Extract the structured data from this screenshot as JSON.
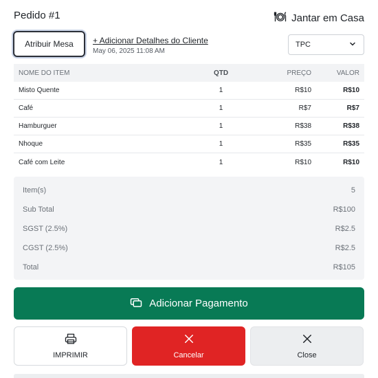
{
  "header": {
    "order_title": "Pedido #1",
    "order_type": "Jantar em Casa"
  },
  "actions": {
    "assign_table": "Atribuir Mesa",
    "add_details": "+ Adicionar Detalhes do Cliente",
    "date": "May 06, 2025 11:08 AM"
  },
  "select": {
    "value": "TPC"
  },
  "table": {
    "headers": {
      "name": "NOME DO ITEM",
      "qty": "QTD",
      "price": "PREÇO",
      "total": "VALOR"
    },
    "rows": [
      {
        "name": "Misto Quente",
        "qty": "1",
        "price": "R$10",
        "total": "R$10"
      },
      {
        "name": "Café",
        "qty": "1",
        "price": "R$7",
        "total": "R$7"
      },
      {
        "name": "Hamburguer",
        "qty": "1",
        "price": "R$38",
        "total": "R$38"
      },
      {
        "name": "Nhoque",
        "qty": "1",
        "price": "R$35",
        "total": "R$35"
      },
      {
        "name": "Café com Leite",
        "qty": "1",
        "price": "R$10",
        "total": "R$10"
      }
    ]
  },
  "summary": [
    {
      "label": "Item(s)",
      "value": "5"
    },
    {
      "label": "Sub Total",
      "value": "R$100"
    },
    {
      "label": "SGST (2.5%)",
      "value": "R$2.5"
    },
    {
      "label": "CGST (2.5%)",
      "value": "R$2.5"
    },
    {
      "label": "Total",
      "value": "R$105"
    }
  ],
  "buttons": {
    "add_payment": "Adicionar Pagamento",
    "print": "IMPRIMIR",
    "cancel": "Cancelar",
    "close": "Close"
  },
  "colors": {
    "primary": "#087a55",
    "danger": "#e02424",
    "muted": "#f3f4f6"
  }
}
